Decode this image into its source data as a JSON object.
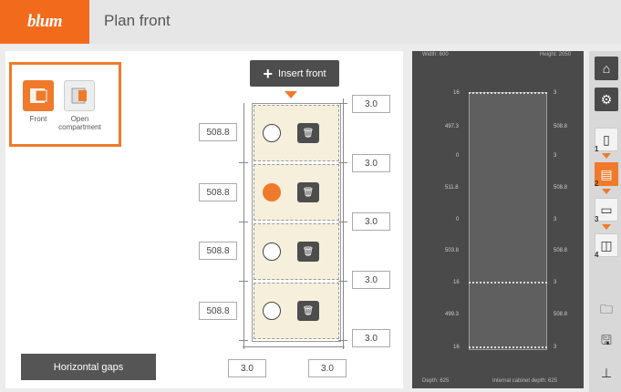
{
  "header": {
    "logo_text": "blum",
    "title": "Plan front"
  },
  "tools": [
    {
      "label": "Front",
      "active": true
    },
    {
      "label": "Open compartment",
      "active": false
    }
  ],
  "insert_button": {
    "label": "Insert front"
  },
  "horizontal_gaps_button": {
    "label": "Horizontal gaps"
  },
  "front_heights": [
    "508.8",
    "508.8",
    "508.8",
    "508.8"
  ],
  "gap_values": [
    "3.0",
    "3.0",
    "3.0",
    "3.0",
    "3.0"
  ],
  "bottom_values": [
    "3.0",
    "3.0"
  ],
  "fronts": [
    {
      "selected": false
    },
    {
      "selected": true
    },
    {
      "selected": false
    },
    {
      "selected": false
    }
  ],
  "preview": {
    "width_label": "Width: 600",
    "height_label": "Height: 2050",
    "depth_label": "Depth: 625",
    "internal_depth_label": "Internal cabinet depth: 625",
    "left_numbers": [
      "16",
      "497.3",
      "0",
      "511.8",
      "0",
      "503.8",
      "16",
      "499.3",
      "16"
    ],
    "right_numbers": [
      "3",
      "508.8",
      "3",
      "508.8",
      "3",
      "508.8",
      "3",
      "508.8",
      "3"
    ]
  },
  "sidebar": {
    "home_icon": "home-icon",
    "cabinet_settings_icon": "cabinet-settings-icon",
    "steps": [
      "1",
      "2",
      "3",
      "4"
    ],
    "open_icon": "folder-open-icon",
    "save_icon": "save-icon",
    "export_icon": "export-icon"
  },
  "colors": {
    "accent": "#f07a2b",
    "dark": "#4a4a4a",
    "front_fill": "#f6efdc"
  }
}
